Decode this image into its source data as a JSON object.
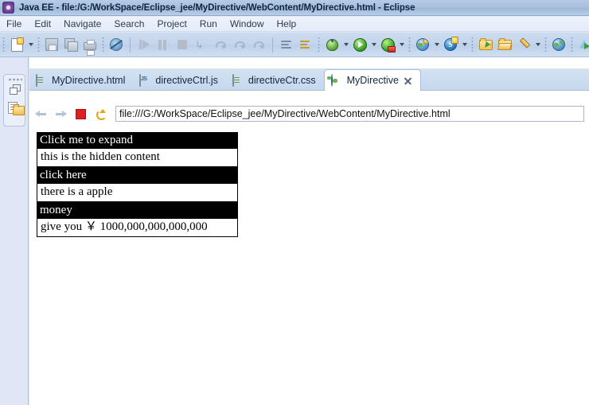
{
  "window": {
    "title": "Java EE - file:/G:/WorkSpace/Eclipse_jee/MyDirective/WebContent/MyDirective.html - Eclipse",
    "logo_icon": "eclipse-logo-icon"
  },
  "menubar": {
    "items": [
      {
        "label": "File"
      },
      {
        "label": "Edit"
      },
      {
        "label": "Navigate"
      },
      {
        "label": "Search"
      },
      {
        "label": "Project"
      },
      {
        "label": "Run"
      },
      {
        "label": "Window"
      },
      {
        "label": "Help"
      }
    ]
  },
  "toolbar": {
    "buttons": [
      {
        "name": "new-file-button",
        "icon": "new-file-icon"
      },
      {
        "name": "new-file-dropdown",
        "icon": "chevron-down-icon"
      },
      {
        "name": "save-button",
        "icon": "save-icon"
      },
      {
        "name": "save-all-button",
        "icon": "save-all-icon"
      },
      {
        "name": "print-button",
        "icon": "print-icon"
      },
      {
        "name": "skip-breakpoints-button",
        "icon": "no-breakpoint-icon"
      },
      {
        "name": "resume-button",
        "icon": "resume-icon"
      },
      {
        "name": "suspend-button",
        "icon": "suspend-icon"
      },
      {
        "name": "terminate-button",
        "icon": "terminate-icon"
      },
      {
        "name": "disconnect-button",
        "icon": "disconnect-icon"
      },
      {
        "name": "step-into-button",
        "icon": "step-into-icon"
      },
      {
        "name": "step-over-button",
        "icon": "step-over-icon"
      },
      {
        "name": "step-return-button",
        "icon": "step-return-icon"
      },
      {
        "name": "open-type-button",
        "icon": "open-type-icon"
      },
      {
        "name": "open-task-button",
        "icon": "open-task-icon"
      },
      {
        "name": "debug-button",
        "icon": "debug-bug-icon"
      },
      {
        "name": "debug-dropdown",
        "icon": "chevron-down-icon"
      },
      {
        "name": "run-button",
        "icon": "run-play-icon"
      },
      {
        "name": "run-dropdown",
        "icon": "chevron-down-icon"
      },
      {
        "name": "run-on-server-button",
        "icon": "run-server-icon"
      },
      {
        "name": "run-on-server-dropdown",
        "icon": "chevron-down-icon"
      },
      {
        "name": "new-web-project-button",
        "icon": "new-web-project-icon"
      },
      {
        "name": "new-web-project-dropdown",
        "icon": "chevron-down-icon"
      },
      {
        "name": "new-servlet-button",
        "icon": "new-servlet-icon"
      },
      {
        "name": "new-servlet-dropdown",
        "icon": "chevron-down-icon"
      },
      {
        "name": "open-resource-button",
        "icon": "folder-go-icon"
      },
      {
        "name": "open-folder-button",
        "icon": "folder-open-icon"
      },
      {
        "name": "edit-button",
        "icon": "pencil-icon"
      },
      {
        "name": "edit-dropdown",
        "icon": "chevron-down-icon"
      },
      {
        "name": "web-browser-button",
        "icon": "globe-icon"
      },
      {
        "name": "run-as-button",
        "icon": "run-as-icon"
      },
      {
        "name": "import-button",
        "icon": "download-icon"
      }
    ]
  },
  "fastview": {
    "restore_label": "restore-icon",
    "project_explorer_label": "project-explorer-icon"
  },
  "editor": {
    "tabs": [
      {
        "label": "MyDirective.html",
        "icon": "html-file-icon",
        "active": false,
        "closable": false
      },
      {
        "label": "directiveCtrl.js",
        "icon": "js-file-icon",
        "active": false,
        "closable": false
      },
      {
        "label": "directiveCtr.css",
        "icon": "css-file-icon",
        "active": false,
        "closable": false
      },
      {
        "label": "MyDirective",
        "icon": "globe-icon",
        "active": true,
        "closable": true
      }
    ]
  },
  "browser": {
    "back_icon": "back-arrow-icon",
    "forward_icon": "forward-arrow-icon",
    "stop_icon": "stop-icon",
    "refresh_icon": "refresh-icon",
    "url": "file:///G:/WorkSpace/Eclipse_jee/MyDirective/WebContent/MyDirective.html"
  },
  "content": {
    "accordion": [
      {
        "header": "Click me to expand",
        "body": "this is the hidden content"
      },
      {
        "header": "click here",
        "body": "there is a apple"
      },
      {
        "header": "money",
        "body": "give you ￥ 1000,000,000,000,000"
      }
    ]
  },
  "colors": {
    "title_bar": "#a8c0de",
    "toolbar": "#c3d5ec",
    "tab_strip": "#cbdcf0",
    "accent_black": "#000000",
    "page_background": "#ffffff",
    "fastview_background": "#dfe6f5"
  }
}
